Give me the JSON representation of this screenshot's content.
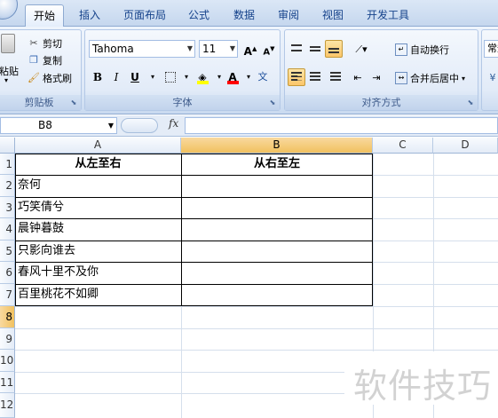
{
  "ribbon_tabs": [
    "开始",
    "插入",
    "页面布局",
    "公式",
    "数据",
    "审阅",
    "视图",
    "开发工具"
  ],
  "clipboard": {
    "paste_label": "粘贴",
    "cut_label": "剪切",
    "copy_label": "复制",
    "format_painter_label": "格式刷",
    "group_label": "剪贴板"
  },
  "font": {
    "name": "Tahoma",
    "size": "11",
    "bold": "B",
    "italic": "I",
    "underline": "U",
    "group_label": "字体",
    "grow_label": "A",
    "shrink_label": "A",
    "phonetic_label": "文",
    "font_color": "#ff0000",
    "fill_color": "#ffff00"
  },
  "alignment": {
    "wrap_text_label": "自动换行",
    "merge_center_label": "合并后居中",
    "group_label": "对齐方式"
  },
  "number": {
    "format_label": "常规"
  },
  "formula_bar": {
    "name_box": "B8",
    "fx": "fx",
    "formula": ""
  },
  "sheet": {
    "columns": [
      "A",
      "B",
      "C",
      "D"
    ],
    "rows": [
      "1",
      "2",
      "3",
      "4",
      "5",
      "6",
      "7",
      "8",
      "9",
      "10",
      "11",
      "12"
    ],
    "selected_cell": "B8",
    "header_row": [
      "从左至右",
      "从右至左"
    ],
    "column_a_values": [
      "奈何",
      "巧笑倩兮",
      "晨钟暮鼓",
      "只影向谁去",
      "春风十里不及你",
      "百里桃花不如卿"
    ],
    "column_b_values": [
      "",
      "",
      "",
      "",
      "",
      ""
    ]
  },
  "watermark": "软件技巧"
}
